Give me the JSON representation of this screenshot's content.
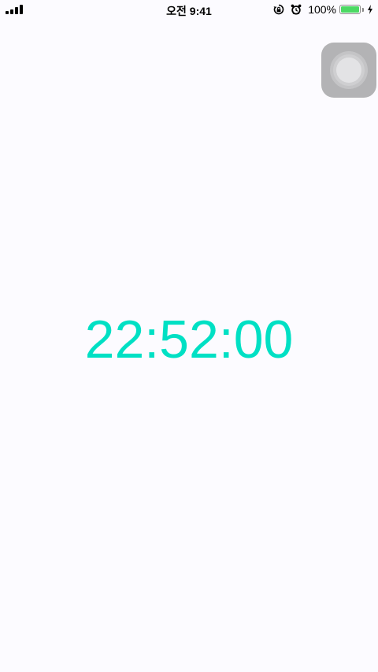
{
  "status_bar": {
    "clock": "오전 9:41",
    "battery_percent": "100%",
    "battery_level": 1.0,
    "signal_bars": 4,
    "icons": [
      "signal-icon",
      "rotation-lock-icon",
      "alarm-icon",
      "battery-icon",
      "charging-bolt-icon"
    ]
  },
  "colors": {
    "accent": "#00e0c4",
    "background": "#fcfbff",
    "battery_fill": "#4cd964"
  },
  "main": {
    "time": "22:52:00"
  },
  "assistive_touch": {
    "icon": "assistive-touch-icon"
  }
}
